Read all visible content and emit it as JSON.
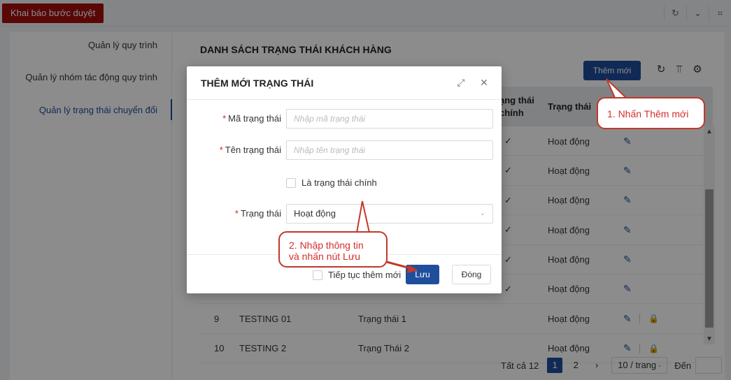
{
  "topbar": {
    "title": "Khai báo bước duyệt"
  },
  "sidebar": {
    "items": [
      {
        "label": "Quản lý quy trình"
      },
      {
        "label": "Quản lý nhóm tác động quy trình"
      },
      {
        "label": "Quản lý trạng thái chuyển đổi"
      }
    ]
  },
  "main": {
    "title": "DANH SÁCH TRẠNG THÁI KHÁCH HÀNG",
    "add_button": "Thêm mới",
    "columns": {
      "main_status": "ạng thái\nchính",
      "main_status_l1": "ạng thái",
      "main_status_l2": "chính",
      "status": "Trạng thái"
    },
    "rows": [
      {
        "stt": "",
        "code": "",
        "name": "",
        "main": "✓",
        "status": "Hoạt động",
        "locked": false
      },
      {
        "stt": "",
        "code": "",
        "name": "",
        "main": "✓",
        "status": "Hoạt động",
        "locked": false
      },
      {
        "stt": "",
        "code": "",
        "name": "",
        "main": "✓",
        "status": "Hoạt động",
        "locked": false
      },
      {
        "stt": "",
        "code": "",
        "name": "",
        "main": "✓",
        "status": "Hoạt động",
        "locked": false
      },
      {
        "stt": "",
        "code": "",
        "name": "",
        "main": "✓",
        "status": "Hoạt động",
        "locked": false
      },
      {
        "stt": "",
        "code": "",
        "name": "",
        "main": "✓",
        "status": "Hoạt động",
        "locked": false
      },
      {
        "stt": "9",
        "code": "TESTING 01",
        "name": "Trạng thái 1",
        "main": "",
        "status": "Hoạt động",
        "locked": true
      },
      {
        "stt": "10",
        "code": "TESTING 2",
        "name": "Trạng Thái 2",
        "main": "",
        "status": "Hoạt động",
        "locked": true
      }
    ]
  },
  "pagination": {
    "total": "Tất cả 12",
    "pages": [
      "1",
      "2"
    ],
    "current": "1",
    "page_size": "10 / trang",
    "goto_label": "Đến"
  },
  "modal": {
    "title": "THÊM MỚI TRẠNG THÁI",
    "code_label": "Mã trạng thái",
    "code_placeholder": "Nhập mã trạng thái",
    "name_label": "Tên trạng thái",
    "name_placeholder": "Nhập tên trạng thái",
    "is_main_label": "Là trạng thái chính",
    "status_label": "Trạng thái",
    "status_value": "Hoạt động",
    "continue_label": "Tiếp tục thêm mới",
    "save_button": "Lưu",
    "close_button": "Đóng"
  },
  "callouts": {
    "step1": "1. Nhấn Thêm mới",
    "step2_line1": "2. Nhập thông tin",
    "step2_line2": "và nhấn nút Lưu"
  },
  "colors": {
    "brand_red": "#a30d0d",
    "primary_blue": "#1f4e9c",
    "callout_red": "#d62e2e"
  }
}
